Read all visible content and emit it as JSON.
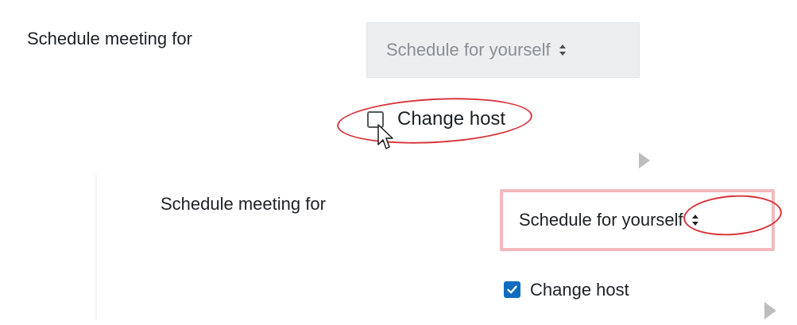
{
  "screens": [
    {
      "schedule_label": "Schedule meeting for",
      "schedule_select_value": "Schedule for yourself",
      "change_host_label": "Change host",
      "change_host_checked": false,
      "select_disabled": true
    },
    {
      "schedule_label": "Schedule meeting for",
      "schedule_select_value": "Schedule for yourself",
      "change_host_label": "Change host",
      "change_host_checked": true,
      "select_disabled": false
    }
  ],
  "colors": {
    "annotation_red": "#d8333a",
    "checkbox_checked": "#0f6cbf",
    "select_disabled_bg": "#eceef0",
    "select_focus_border": "#f3b9bd"
  },
  "icons": {
    "select_arrows": "updown-arrows-icon",
    "cursor": "mouse-pointer-icon",
    "checkmark": "checkmark-icon"
  }
}
